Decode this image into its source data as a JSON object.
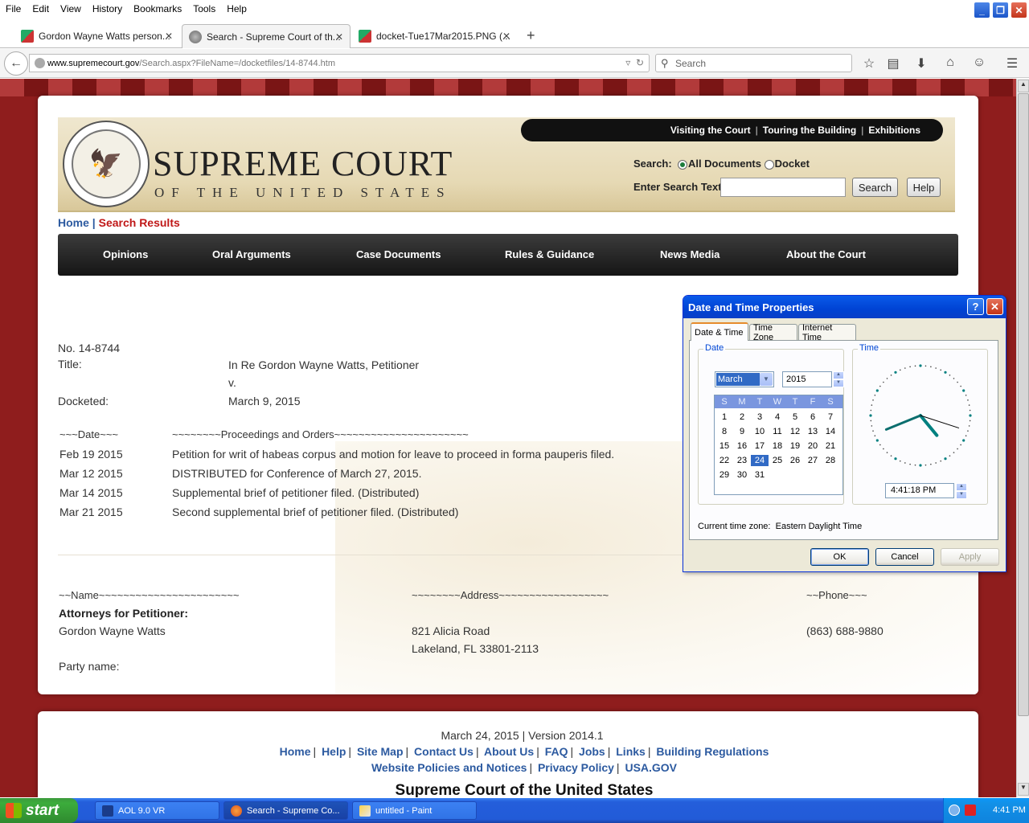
{
  "browser": {
    "menu": [
      "File",
      "Edit",
      "View",
      "History",
      "Bookmarks",
      "Tools",
      "Help"
    ],
    "tabs": [
      {
        "label": "Gordon Wayne Watts person..."
      },
      {
        "label": "Search - Supreme Court of th..."
      },
      {
        "label": "docket-Tue17Mar2015.PNG (..."
      }
    ],
    "url_host": "www.supremecourt.gov",
    "url_path": "/Search.aspx?FileName=/docketfiles/14-8744.htm",
    "search_placeholder": "Search"
  },
  "site": {
    "title": "SUPREME COURT",
    "subtitle": "OF THE UNITED STATES",
    "top_links": [
      "Visiting the Court",
      "Touring the Building",
      "Exhibitions"
    ],
    "search_label": "Search:",
    "radio_all": "All Documents",
    "radio_docket": "Docket",
    "enter_text_label": "Enter Search Text:",
    "search_button": "Search",
    "help_button": "Help",
    "breadcrumb_home": "Home",
    "breadcrumb_sep": "|",
    "breadcrumb_current": "Search Results",
    "nav": [
      "Opinions",
      "Oral Arguments",
      "Case Documents",
      "Rules & Guidance",
      "News Media",
      "About the Court"
    ]
  },
  "docket": {
    "number": "No. 14-8744",
    "title_label": "Title:",
    "title_value": "In Re Gordon Wayne Watts, Petitioner",
    "title_v": "v.",
    "docketed_label": "Docketed:",
    "docketed_value": "March 9, 2015",
    "date_header": "~~~Date~~~",
    "proceedings_header": "~~~~~~~~Proceedings  and  Orders~~~~~~~~~~~~~~~~~~~~~~",
    "entries": [
      {
        "date": "Feb 19 2015",
        "text": "Petition for writ of habeas corpus and motion for leave to proceed in forma pauperis filed."
      },
      {
        "date": "Mar 12 2015",
        "text": "DISTRIBUTED for Conference of March 27, 2015."
      },
      {
        "date": "Mar 14 2015",
        "text": "Supplemental brief of petitioner filed. (Distributed)"
      },
      {
        "date": "Mar 21 2015",
        "text": "Second supplemental brief of petitioner filed. (Distributed)"
      }
    ],
    "name_header": "~~Name~~~~~~~~~~~~~~~~~~~~~~~",
    "address_header": "~~~~~~~~Address~~~~~~~~~~~~~~~~~~",
    "phone_header": "~~Phone~~~",
    "attorneys_label": "Attorneys for Petitioner:",
    "attorney_name": "Gordon Wayne Watts",
    "address_line1": "821 Alicia Road",
    "address_line2": "Lakeland, FL  33801-2113",
    "phone": "(863) 688-9880",
    "party_label": "Party name:"
  },
  "footer": {
    "date_version": "March 24, 2015 | Version 2014.1",
    "links1": [
      "Home",
      "Help",
      "Site Map",
      "Contact Us",
      "About Us",
      "FAQ",
      "Jobs",
      "Links",
      "Building Regulations"
    ],
    "links2": [
      "Website Policies and Notices",
      "Privacy Policy",
      "USA.GOV"
    ],
    "title": "Supreme Court of the United States"
  },
  "dialog": {
    "title": "Date and Time Properties",
    "help": "?",
    "tabs": [
      "Date & Time",
      "Time Zone",
      "Internet Time"
    ],
    "date_group": "Date",
    "time_group": "Time",
    "month": "March",
    "year": "2015",
    "weekdays": [
      "S",
      "M",
      "T",
      "W",
      "T",
      "F",
      "S"
    ],
    "days": [
      [
        "1",
        "2",
        "3",
        "4",
        "5",
        "6",
        "7"
      ],
      [
        "8",
        "9",
        "10",
        "11",
        "12",
        "13",
        "14"
      ],
      [
        "15",
        "16",
        "17",
        "18",
        "19",
        "20",
        "21"
      ],
      [
        "22",
        "23",
        "24",
        "25",
        "26",
        "27",
        "28"
      ],
      [
        "29",
        "30",
        "31",
        "",
        "",
        "",
        ""
      ]
    ],
    "selected_day": "24",
    "time": "4:41:18 PM",
    "timezone_label": "Current time zone:",
    "timezone": "Eastern Daylight Time",
    "ok": "OK",
    "cancel": "Cancel",
    "apply": "Apply"
  },
  "taskbar": {
    "start": "start",
    "tasks": [
      "AOL 9.0 VR",
      "Search - Supreme Co...",
      "untitled - Paint"
    ],
    "clock": "4:41 PM"
  }
}
